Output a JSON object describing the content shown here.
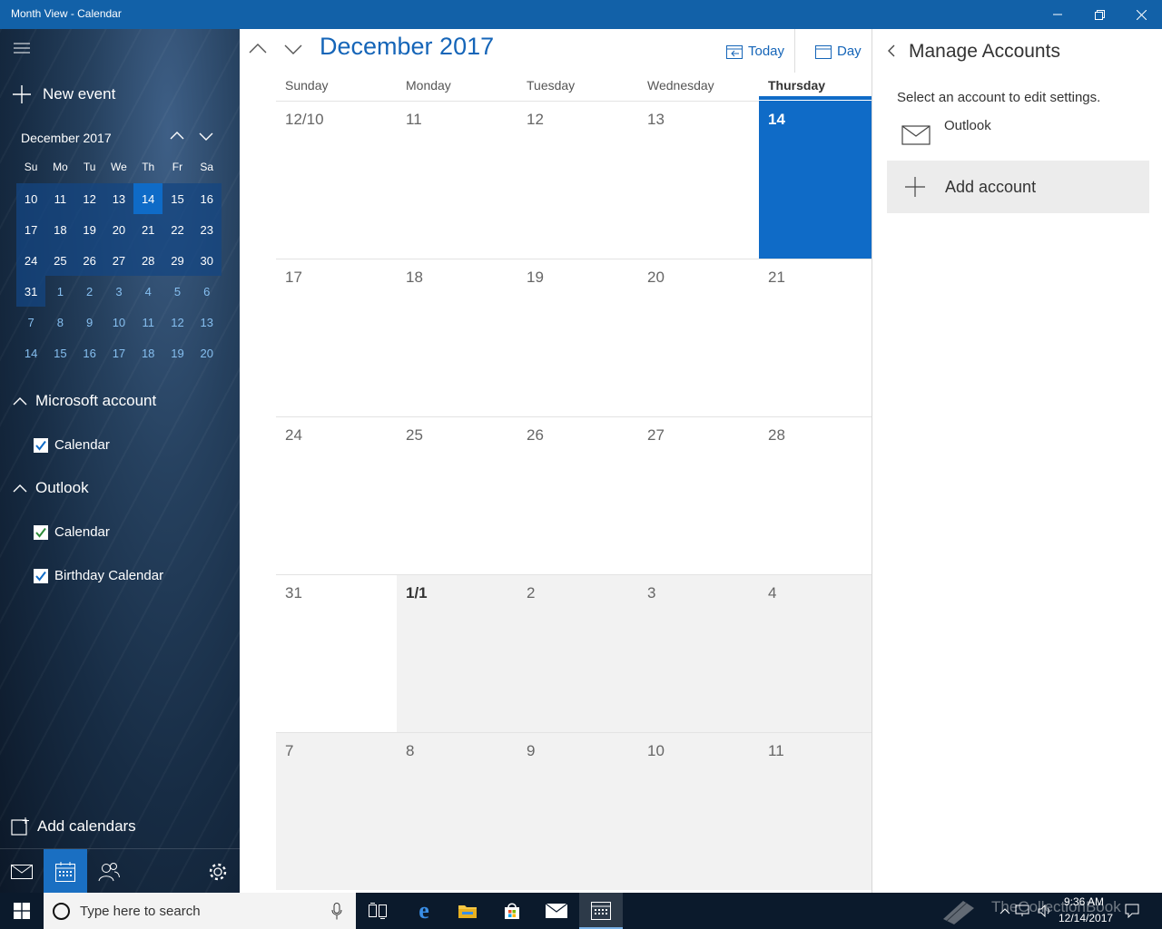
{
  "window": {
    "title": "Month View - Calendar"
  },
  "sidebar": {
    "new_event": "New event",
    "mini": {
      "title": "December 2017",
      "dows": [
        "Su",
        "Mo",
        "Tu",
        "We",
        "Th",
        "Fr",
        "Sa"
      ],
      "weeks": [
        [
          "10",
          "11",
          "12",
          "13",
          "14",
          "15",
          "16"
        ],
        [
          "17",
          "18",
          "19",
          "20",
          "21",
          "22",
          "23"
        ],
        [
          "24",
          "25",
          "26",
          "27",
          "28",
          "29",
          "30"
        ],
        [
          "31",
          "1",
          "2",
          "3",
          "4",
          "5",
          "6"
        ],
        [
          "7",
          "8",
          "9",
          "10",
          "11",
          "12",
          "13"
        ],
        [
          "14",
          "15",
          "16",
          "17",
          "18",
          "19",
          "20"
        ]
      ]
    },
    "groups": [
      {
        "name": "Microsoft account",
        "calendars": [
          "Calendar"
        ]
      },
      {
        "name": "Outlook",
        "calendars": [
          "Calendar",
          "Birthday Calendar"
        ]
      }
    ],
    "add_calendars": "Add calendars"
  },
  "toolbar": {
    "month_label": "December 2017",
    "today": "Today",
    "day": "Day"
  },
  "grid": {
    "dow": [
      "Sunday",
      "Monday",
      "Tuesday",
      "Wednesday",
      "Thursday"
    ],
    "weeks": [
      [
        "12/10",
        "11",
        "12",
        "13",
        "14"
      ],
      [
        "17",
        "18",
        "19",
        "20",
        "21"
      ],
      [
        "24",
        "25",
        "26",
        "27",
        "28"
      ],
      [
        "31",
        "1/1",
        "2",
        "3",
        "4"
      ],
      [
        "7",
        "8",
        "9",
        "10",
        "11"
      ]
    ]
  },
  "panel": {
    "title": "Manage Accounts",
    "subtitle": "Select an account to edit settings.",
    "account": "Outlook",
    "add_account": "Add account"
  },
  "taskbar": {
    "search_placeholder": "Type here to search",
    "time": "9:36 AM",
    "date": "12/14/2017",
    "watermark": "TheCollectionBook"
  },
  "colors": {
    "accent": "#0f6bc7",
    "titlebar": "#1261a8",
    "taskbar": "#0b1a2c"
  }
}
